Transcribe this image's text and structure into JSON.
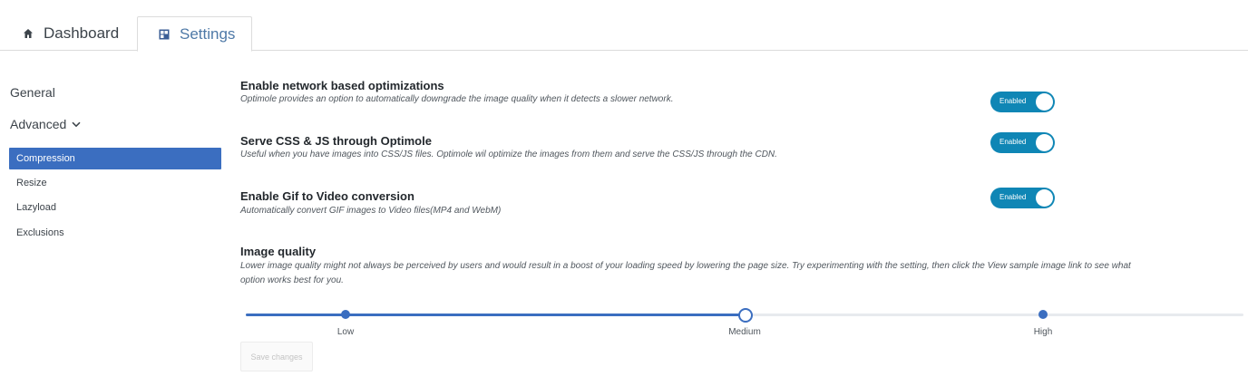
{
  "tabs": [
    {
      "label": "Dashboard",
      "icon": "home-icon",
      "active": false
    },
    {
      "label": "Settings",
      "icon": "grid-icon",
      "active": true
    }
  ],
  "sidebar": {
    "general_label": "General",
    "advanced_label": "Advanced",
    "advanced_icon": "chevron-down-icon",
    "sub_items": [
      {
        "label": "Compression",
        "active": true
      },
      {
        "label": "Resize",
        "active": false
      },
      {
        "label": "Lazyload",
        "active": false
      },
      {
        "label": "Exclusions",
        "active": false
      }
    ],
    "active_color": "#3b6ec0"
  },
  "options": [
    {
      "title": "Enable network based optimizations",
      "description": "Optimole provides an option to automatically downgrade the image quality when it detects a slower network.",
      "toggle_label": "Enabled",
      "enabled": true
    },
    {
      "title": "Serve CSS & JS through Optimole",
      "description": "Useful when you have images into CSS/JS files. Optimole wil optimize the images from them and serve the CSS/JS through the CDN.",
      "toggle_label": "Enabled",
      "enabled": true
    },
    {
      "title": "Enable Gif to Video conversion",
      "description": "Automatically convert GIF images to Video files(MP4 and WebM)",
      "toggle_label": "Enabled",
      "enabled": true
    }
  ],
  "toggle_color": "#0f86b5",
  "image_quality": {
    "title": "Image quality",
    "description_line1": "Lower image quality might not always be perceived by users and would result in a boost of your loading speed by lowering the page size. Try experimenting with the setting, then click the View sample image link to see what",
    "description_line2": "option works best for you.",
    "levels": [
      "Low",
      "Medium",
      "High"
    ],
    "selected": "Medium",
    "accent_color": "#3b6ec0"
  },
  "save_button": {
    "label": "Save changes",
    "disabled": true
  }
}
